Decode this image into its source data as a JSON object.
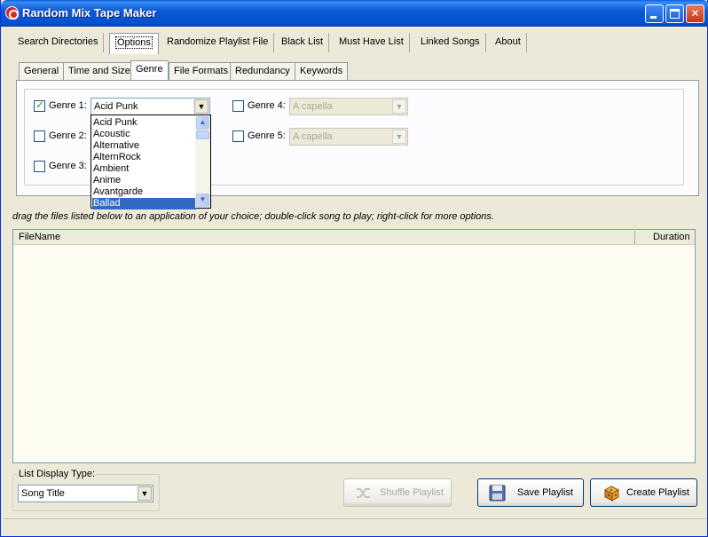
{
  "window": {
    "title": "Random Mix Tape Maker"
  },
  "main_tabs": [
    "Search Directories",
    "Options",
    "Randomize Playlist File",
    "Black List",
    "Must Have List",
    "Linked Songs",
    "About"
  ],
  "sub_tabs": [
    "General",
    "Time and Size",
    "Genre",
    "File Formats",
    "Redundancy",
    "Keywords"
  ],
  "genres": {
    "genre1": {
      "label": "Genre 1:",
      "checked": true,
      "value": "Acid Punk"
    },
    "genre2": {
      "label": "Genre 2:",
      "checked": false
    },
    "genre3": {
      "label": "Genre 3:",
      "checked": false
    },
    "genre4": {
      "label": "Genre 4:",
      "checked": false,
      "value": "A capella"
    },
    "genre5": {
      "label": "Genre 5:",
      "checked": false,
      "value": "A capella"
    }
  },
  "dropdown_options": [
    "Acid Punk",
    "Acoustic",
    "Alternative",
    "AlternRock",
    "Ambient",
    "Anime",
    "Avantgarde",
    "Ballad"
  ],
  "dropdown_selected": "Ballad",
  "hint": "drag the files listed below to an application of your choice; double-click song to play; right-click for more options.",
  "file_list": {
    "columns": [
      "FileName",
      "Duration"
    ],
    "rows": []
  },
  "list_display": {
    "label": "List Display Type:",
    "value": "Song Title"
  },
  "buttons": {
    "shuffle": "Shuffle Playlist",
    "save": "Save Playlist",
    "create": "Create Playlist"
  }
}
